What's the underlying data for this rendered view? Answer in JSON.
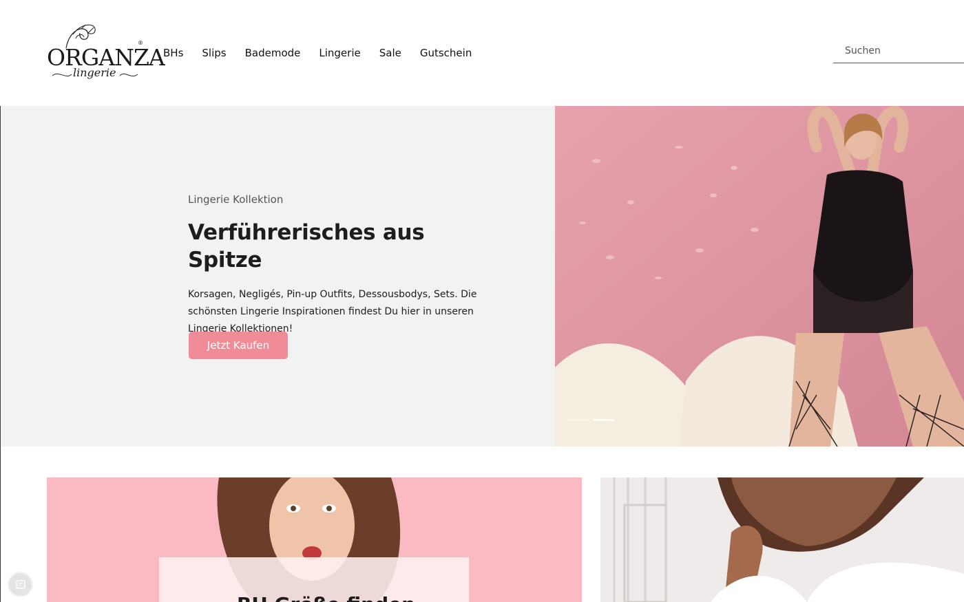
{
  "brand": {
    "name": "ORGANZA",
    "tagline": "lingerie",
    "registered": "®"
  },
  "nav": {
    "items": [
      {
        "label": "BHs"
      },
      {
        "label": "Slips"
      },
      {
        "label": "Bademode"
      },
      {
        "label": "Lingerie"
      },
      {
        "label": "Sale"
      },
      {
        "label": "Gutschein"
      }
    ]
  },
  "search": {
    "placeholder": "Suchen"
  },
  "hero": {
    "eyebrow": "Lingerie Kollektion",
    "title": "Verführerisches aus Spitze",
    "description": "Korsagen, Negligés, Pin-up Outfits, Dessousbodys, Sets. Die schönsten Lingerie Inspirationen findest Du hier in unseren Lingerie Kollektionen!",
    "cta_label": "Jetzt Kaufen",
    "slides": {
      "count": 2,
      "active_index": 1
    }
  },
  "promo": {
    "left_title": "BH Größe finden"
  },
  "colors": {
    "accent": "#f08c97",
    "hero_bg": "#f2f2f2",
    "promo_pink": "#fbbac1"
  },
  "icons": {
    "chat": "chat-icon"
  }
}
